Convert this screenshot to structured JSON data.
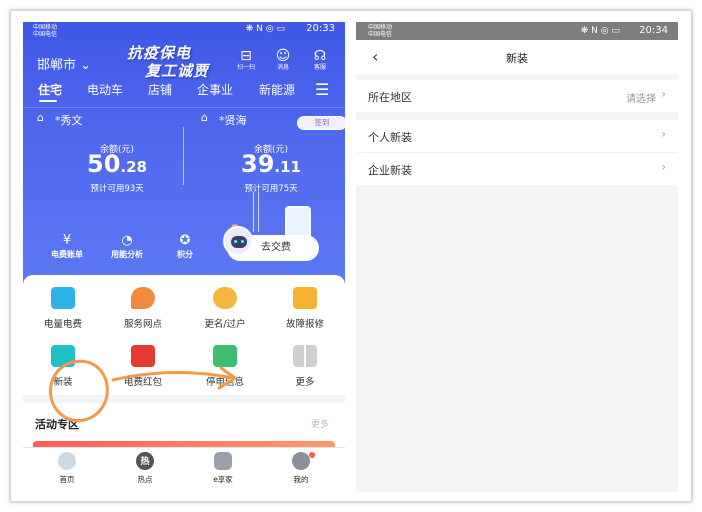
{
  "left": {
    "status": {
      "carrier1": "中国移动",
      "carrier2": "中国电信",
      "icons": "❋ N ◎ ▭",
      "time": "20:33"
    },
    "city": "邯郸市",
    "banner": {
      "line1": "抗疫保电",
      "line2": "复工诚贾"
    },
    "top_icons": [
      {
        "label": "扫一扫",
        "glyph": "⊟",
        "icon": "scan-icon"
      },
      {
        "label": "消息",
        "glyph": "☺",
        "icon": "message-icon"
      },
      {
        "label": "客服",
        "glyph": "☊",
        "icon": "headset-icon"
      }
    ],
    "categories": [
      "住宅",
      "电动车",
      "店铺",
      "企事业",
      "新能源"
    ],
    "accounts": [
      {
        "name": "*秀文",
        "balance_label": "余额(元)",
        "balance_int": "50",
        "balance_dec": ".28",
        "days": "预计可用93天"
      },
      {
        "name": "*贤海",
        "balance_label": "余额(元)",
        "balance_int": "39",
        "balance_dec": ".11",
        "days": "预计可用75天"
      }
    ],
    "signin": "签到",
    "tools": [
      {
        "label": "电费账单",
        "glyph": "¥",
        "icon": "bill-icon"
      },
      {
        "label": "用能分析",
        "glyph": "◔",
        "icon": "analysis-icon"
      },
      {
        "label": "积分",
        "glyph": "✪",
        "icon": "points-icon"
      }
    ],
    "pay_label": "去交费",
    "grid": [
      {
        "label": "电量电费",
        "icon": "electric-fee-icon",
        "color": "#2bb3e8"
      },
      {
        "label": "服务网点",
        "icon": "service-map-icon",
        "color": "#f08a3c"
      },
      {
        "label": "更名/过户",
        "icon": "rename-icon",
        "color": "#f4b640"
      },
      {
        "label": "故障报修",
        "icon": "repair-icon",
        "color": "#f6b232"
      },
      {
        "label": "新装",
        "icon": "new-install-icon",
        "color": "#20c0c8"
      },
      {
        "label": "电费红包",
        "icon": "red-packet-icon",
        "color": "#e53a32"
      },
      {
        "label": "停电信息",
        "icon": "outage-info-icon",
        "color": "#3cc070"
      },
      {
        "label": "更多",
        "icon": "more-grid-icon",
        "color": "#c8c8c8"
      }
    ],
    "activity": {
      "title": "活动专区",
      "more": "更多"
    },
    "tabs": [
      {
        "label": "首页",
        "icon": "home-icon",
        "txt": ""
      },
      {
        "label": "热点",
        "icon": "hot-icon",
        "txt": "热"
      },
      {
        "label": "e享家",
        "icon": "ehome-icon",
        "txt": ""
      },
      {
        "label": "我的",
        "icon": "profile-icon",
        "txt": ""
      }
    ]
  },
  "right": {
    "status": {
      "carrier1": "中国移动",
      "carrier2": "中国电信",
      "icons": "❋ N ◎ ▭",
      "time": "20:34"
    },
    "title": "新装",
    "region": {
      "label": "所在地区",
      "value": "请选择"
    },
    "options": [
      "个人新装",
      "企业新装"
    ]
  }
}
